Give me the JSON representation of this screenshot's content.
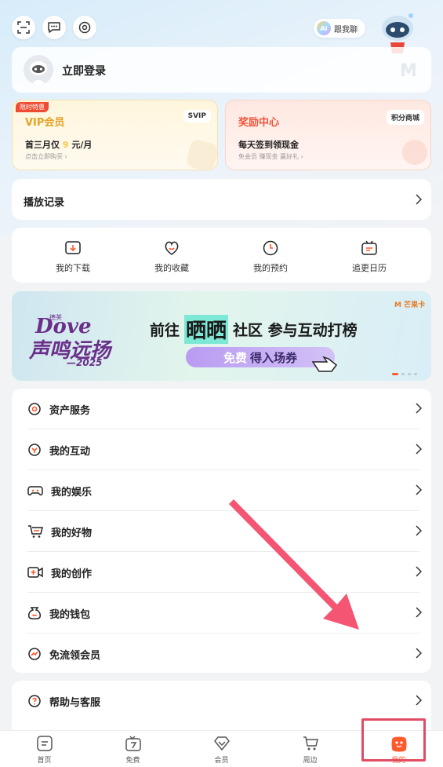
{
  "top": {
    "ai_chat_label": "跟我聊",
    "ai_badge": "AI",
    "login_label": "立即登录"
  },
  "vip_card": {
    "tag": "限时特惠",
    "title": "VIP会员",
    "badge": "SVIP",
    "promo_prefix": "首三月仅",
    "promo_price": "9",
    "promo_suffix": "元/月",
    "sub": "点击立即购买"
  },
  "reward_card": {
    "title": "奖励中心",
    "badge": "积分商城",
    "line1": "每天签到领现金",
    "sub": "免会员 赚现金 赢好礼"
  },
  "history": {
    "label": "播放记录"
  },
  "quick_actions": [
    {
      "label": "我的下载",
      "icon": "download-icon"
    },
    {
      "label": "我的收藏",
      "icon": "favorite-icon"
    },
    {
      "label": "我的预约",
      "icon": "reservation-icon"
    },
    {
      "label": "追更日历",
      "icon": "calendar-icon"
    }
  ],
  "banner": {
    "brand_small": "德芙",
    "brand": "Dove",
    "title_art": "声鸣远扬",
    "year": "2025",
    "sponsor": "芒果卡",
    "headline_prefix": "前往",
    "headline_highlight": "晒晒",
    "headline_suffix": "社区 参与互动打榜",
    "cta_highlight": "免费",
    "cta": "得入场券",
    "pager_total": 4,
    "pager_active": 1
  },
  "menu_group1": [
    {
      "label": "资产服务",
      "icon": "asset-icon"
    },
    {
      "label": "我的互动",
      "icon": "interaction-icon"
    },
    {
      "label": "我的娱乐",
      "icon": "gamepad-icon"
    },
    {
      "label": "我的好物",
      "icon": "shopping-cart-icon"
    },
    {
      "label": "我的创作",
      "icon": "video-camera-icon"
    },
    {
      "label": "我的钱包",
      "icon": "wallet-icon"
    },
    {
      "label": "免流领会员",
      "icon": "data-free-icon"
    }
  ],
  "menu_group2": [
    {
      "label": "帮助与客服",
      "icon": "help-icon"
    }
  ],
  "bottom_nav": [
    {
      "label": "首页",
      "icon": "home-icon"
    },
    {
      "label": "免费",
      "icon": "free-tv-icon"
    },
    {
      "label": "会员",
      "icon": "vip-diamond-icon"
    },
    {
      "label": "周边",
      "icon": "cart-icon"
    },
    {
      "label": "我的",
      "icon": "mine-mascot-icon",
      "active": true
    }
  ],
  "colors": {
    "accent": "#ff5a2b",
    "vip_gold": "#e3a325",
    "reward_red": "#f0553a",
    "highlight_box": "#e24b62",
    "arrow": "#f35572"
  }
}
